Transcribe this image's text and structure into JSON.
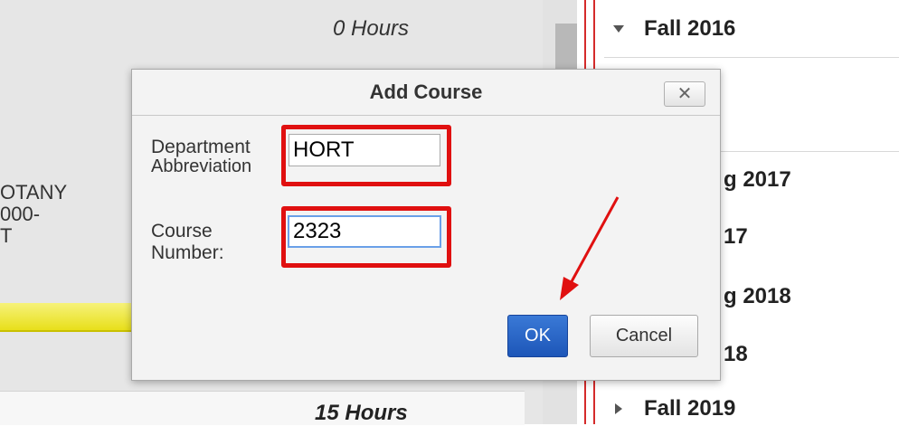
{
  "background": {
    "hours_top": "0 Hours",
    "hours_bottom": "15 Hours",
    "left_lines": [
      "OTANY",
      "000-",
      "T"
    ]
  },
  "terms": [
    "Fall 2016",
    "g 2017",
    "17",
    "g 2018",
    "18",
    "Fall 2019"
  ],
  "dialog": {
    "title": "Add Course",
    "close_glyph": "✕",
    "dept_label_line1": "Department",
    "dept_label_line2": "Abbreviation",
    "dept_value": "HORT",
    "course_label_line1": "Course",
    "course_label_line2": "Number:",
    "course_value": "2323",
    "ok_label": "OK",
    "cancel_label": "Cancel"
  },
  "colors": {
    "highlight": "#e01010",
    "ok_button": "#2563c6",
    "red_rule": "#d52b2b"
  }
}
